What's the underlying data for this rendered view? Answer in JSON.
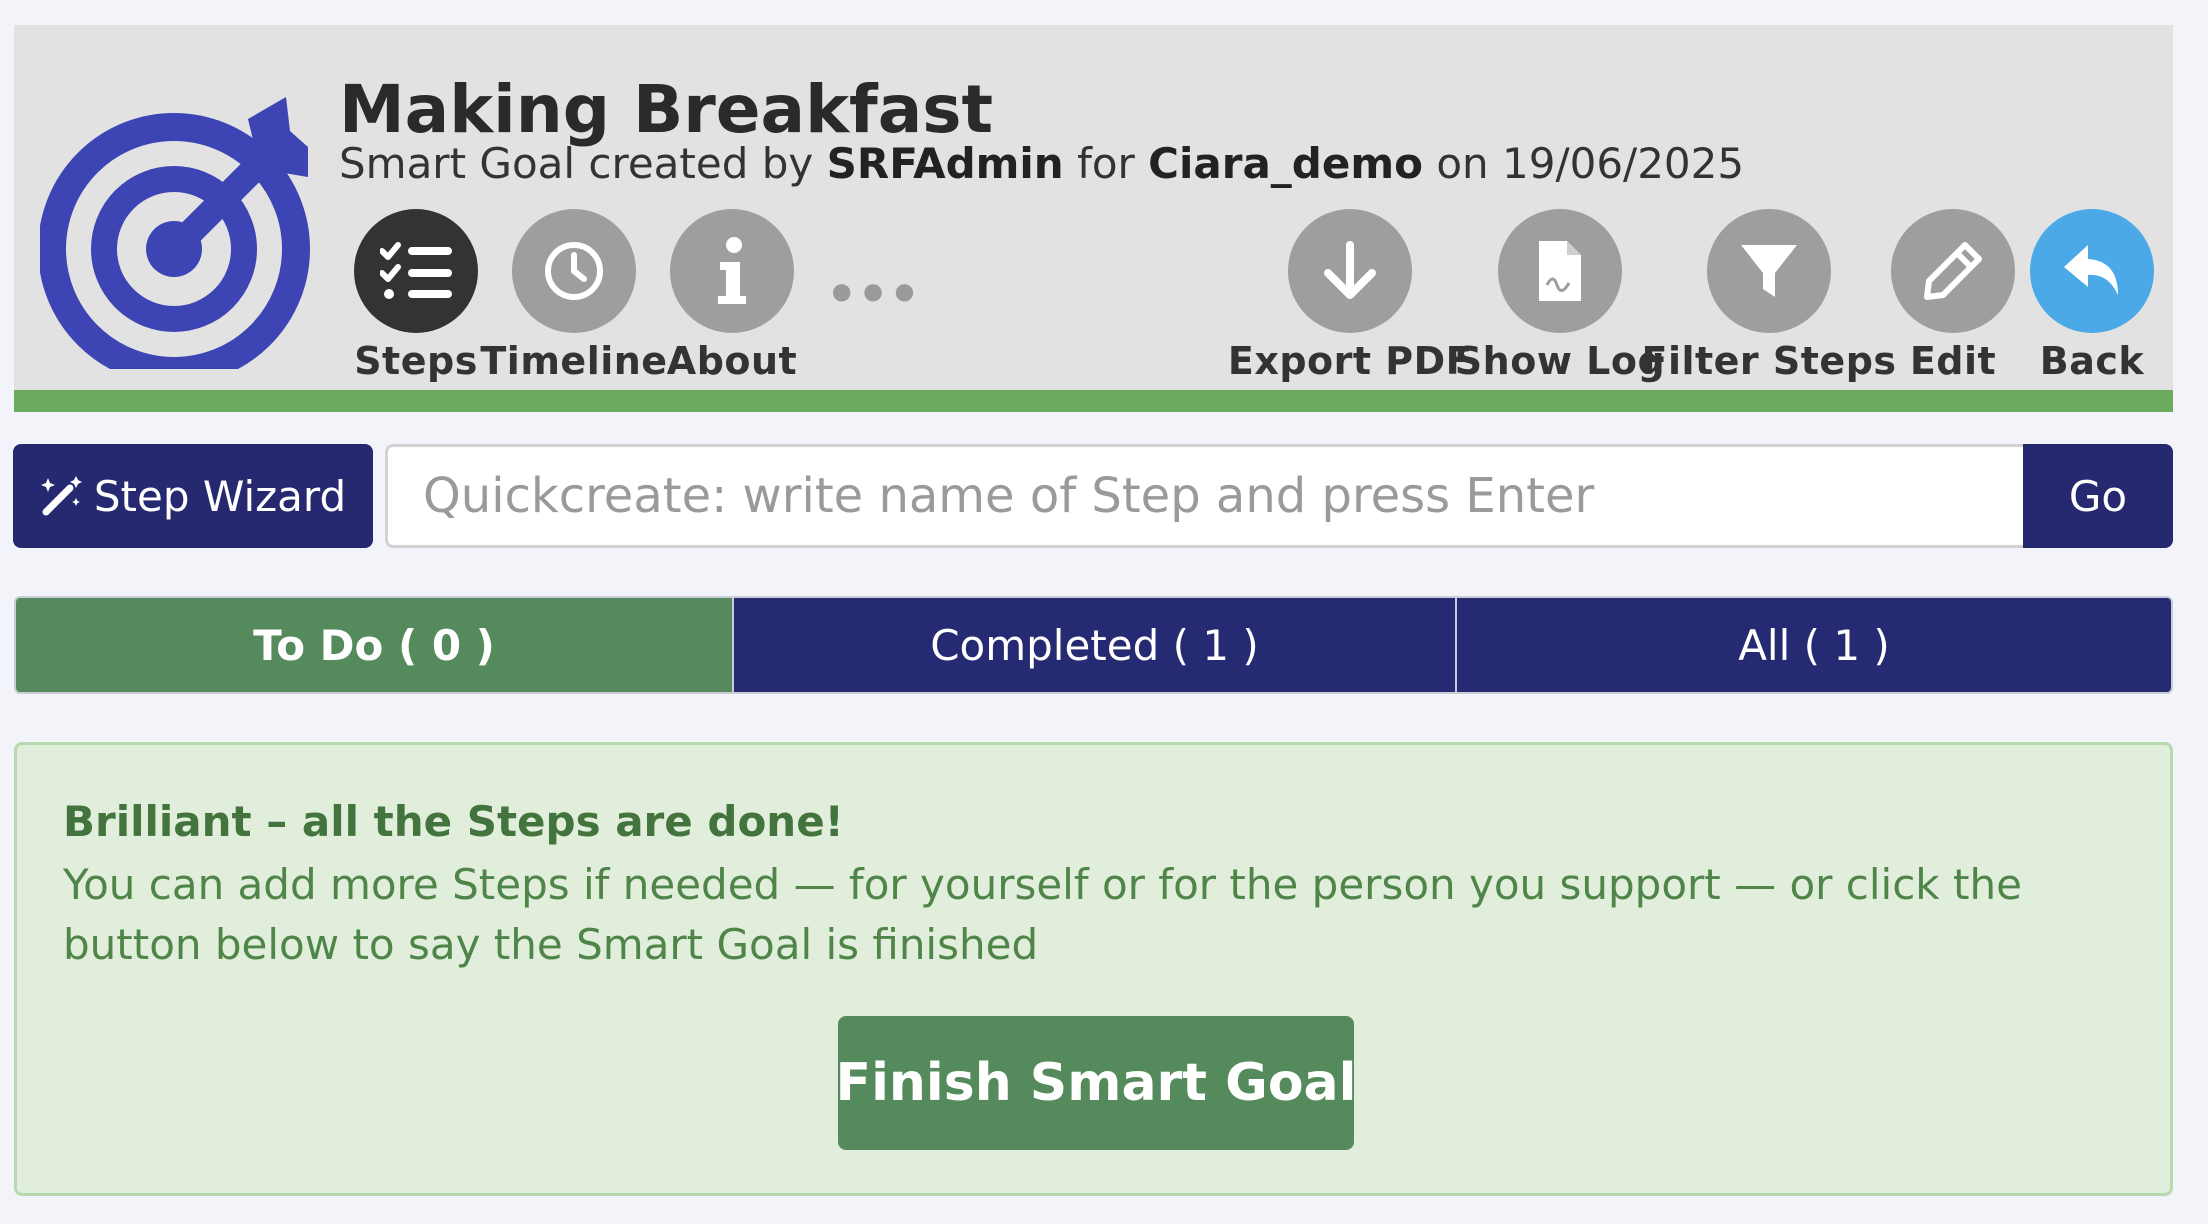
{
  "header": {
    "title": "Making Breakfast",
    "subtitle_prefix": "Smart Goal created by",
    "creator": "SRFAdmin",
    "for_word": "for",
    "target_user": "Ciara_demo",
    "on_word": "on",
    "date": "19/06/2025",
    "accent_color": "#3d44b3",
    "bar_color": "#6aa95e"
  },
  "actions": {
    "steps": {
      "label": "Steps",
      "icon": "checklist-icon"
    },
    "timeline": {
      "label": "Timeline",
      "icon": "clock-icon"
    },
    "about": {
      "label": "About",
      "icon": "info-icon"
    },
    "more": {
      "label": "•••",
      "icon": "more-icon"
    },
    "export_pdf": {
      "label": "Export PDF",
      "icon": "download-icon"
    },
    "show_log": {
      "label": "Show Log",
      "icon": "document-icon"
    },
    "filter_steps": {
      "label": "Filter Steps",
      "icon": "filter-icon"
    },
    "edit": {
      "label": "Edit",
      "icon": "pencil-icon"
    },
    "back": {
      "label": "Back",
      "icon": "back-arrow-icon"
    }
  },
  "quickcreate": {
    "wizard_label": "Step Wizard",
    "placeholder": "Quickcreate: write name of Step and press Enter",
    "value": "",
    "go_label": "Go"
  },
  "tabs": [
    {
      "label": "To Do ( 0 )",
      "active": true
    },
    {
      "label": "Completed ( 1 )",
      "active": false
    },
    {
      "label": "All ( 1 )",
      "active": false
    }
  ],
  "done_panel": {
    "title": "Brilliant – all the Steps are done!",
    "message": "You can add more Steps if needed — for yourself or for the person you support — or click the button below to say the Smart Goal is finished",
    "finish_label": "Finish Smart Goal"
  }
}
